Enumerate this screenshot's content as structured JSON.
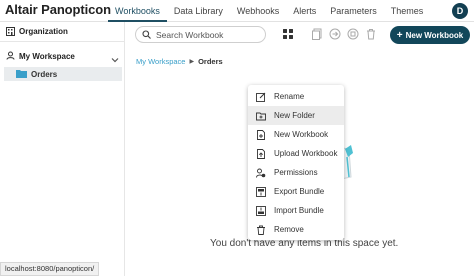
{
  "app": {
    "brand": "Altair Panopticon"
  },
  "nav": {
    "tabs": [
      {
        "label": "Workbooks",
        "active": true
      },
      {
        "label": "Data Library"
      },
      {
        "label": "Webhooks"
      },
      {
        "label": "Alerts"
      },
      {
        "label": "Parameters"
      },
      {
        "label": "Themes"
      }
    ],
    "avatar_initial": "D"
  },
  "sidebar": {
    "organization": "Organization",
    "workspace": "My Workspace",
    "folder": "Orders",
    "status_url": "localhost:8080/panopticon/"
  },
  "toolbar": {
    "search_placeholder": "Search Workbook",
    "new_workbook_label": "New Workbook",
    "icons": [
      "grid-icon",
      "copy-icon",
      "refresh-icon",
      "move-icon",
      "delete-icon"
    ]
  },
  "breadcrumb": {
    "root": "My Workspace",
    "current": "Orders"
  },
  "empty_state": {
    "message": "You don't have any items in this space yet."
  },
  "context_menu": {
    "items": [
      {
        "label": "Rename",
        "icon": "edit-icon"
      },
      {
        "label": "New Folder",
        "icon": "new-folder-icon",
        "hover": true
      },
      {
        "label": "New Workbook",
        "icon": "new-workbook-icon"
      },
      {
        "label": "Upload Workbook",
        "icon": "upload-icon"
      },
      {
        "label": "Permissions",
        "icon": "permissions-icon"
      },
      {
        "label": "Export Bundle",
        "icon": "export-icon"
      },
      {
        "label": "Import Bundle",
        "icon": "import-icon"
      },
      {
        "label": "Remove",
        "icon": "trash-icon"
      }
    ]
  },
  "colors": {
    "primary": "#12475a",
    "link": "#3a9fc9",
    "folder": "#3a9fc9"
  }
}
